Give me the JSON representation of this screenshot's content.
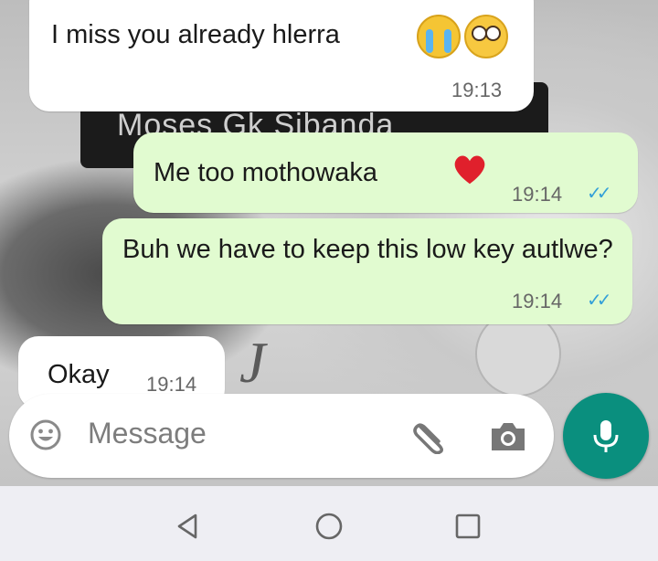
{
  "background": {
    "name_card_text": "Moses Gk Sibanda"
  },
  "messages": [
    {
      "direction": "incoming",
      "text": "I miss you already hlerra",
      "emojis": [
        "loudly-crying-face-icon",
        "pleading-face-icon"
      ],
      "time": "19:13"
    },
    {
      "direction": "outgoing",
      "text": "Me too mothowaka",
      "emojis": [
        "red-heart-icon"
      ],
      "time": "19:14",
      "status": "read"
    },
    {
      "direction": "outgoing",
      "text": "Buh we have to keep this low key autlwe?",
      "time": "19:14",
      "status": "read"
    },
    {
      "direction": "incoming",
      "text": "Okay",
      "time": "19:14"
    }
  ],
  "composer": {
    "placeholder": "Message",
    "icons": [
      "emoji-icon",
      "paperclip-icon",
      "camera-icon",
      "microphone-icon"
    ]
  },
  "navigation": {
    "buttons": [
      "back-icon",
      "home-icon",
      "recents-icon"
    ]
  },
  "colors": {
    "outgoing_bubble": "#e1fbd0",
    "incoming_bubble": "#ffffff",
    "read_ticks": "#34a0d8",
    "mic_button": "#0a8f7e"
  }
}
